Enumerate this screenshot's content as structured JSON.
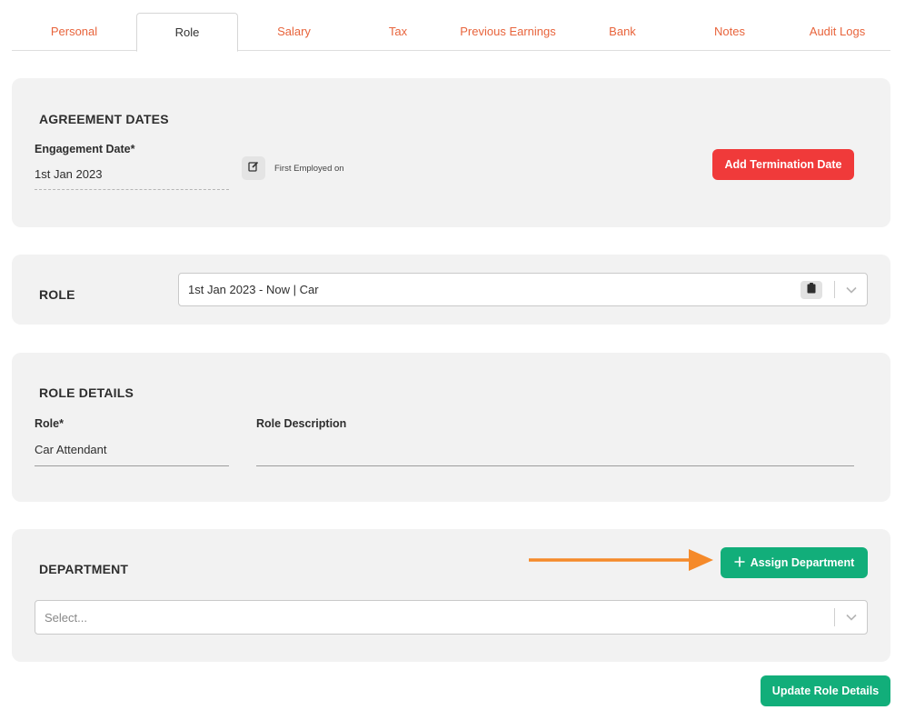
{
  "tabs": [
    {
      "label": "Personal"
    },
    {
      "label": "Role",
      "active": true
    },
    {
      "label": "Salary"
    },
    {
      "label": "Tax"
    },
    {
      "label": "Previous Earnings"
    },
    {
      "label": "Bank"
    },
    {
      "label": "Notes"
    },
    {
      "label": "Audit Logs"
    }
  ],
  "agreement": {
    "title": "AGREEMENT DATES",
    "engagement_label": "Engagement Date*",
    "engagement_value": "1st Jan 2023",
    "first_employed_note": "First Employed on",
    "termination_button": "Add Termination Date"
  },
  "role": {
    "title": "ROLE",
    "selected": "1st Jan 2023 - Now | Car"
  },
  "role_details": {
    "title": "ROLE DETAILS",
    "role_label": "Role*",
    "role_value": "Car Attendant",
    "description_label": "Role Description",
    "description_value": ""
  },
  "department": {
    "title": "DEPARTMENT",
    "assign_button": "Assign Department",
    "select_placeholder": "Select..."
  },
  "footer": {
    "update_button": "Update Role Details"
  },
  "colors": {
    "tab_text": "#e8643c",
    "danger": "#f03a3a",
    "success": "#12ae7a",
    "arrow": "#f58a2a",
    "card_bg": "#f2f2f2"
  }
}
